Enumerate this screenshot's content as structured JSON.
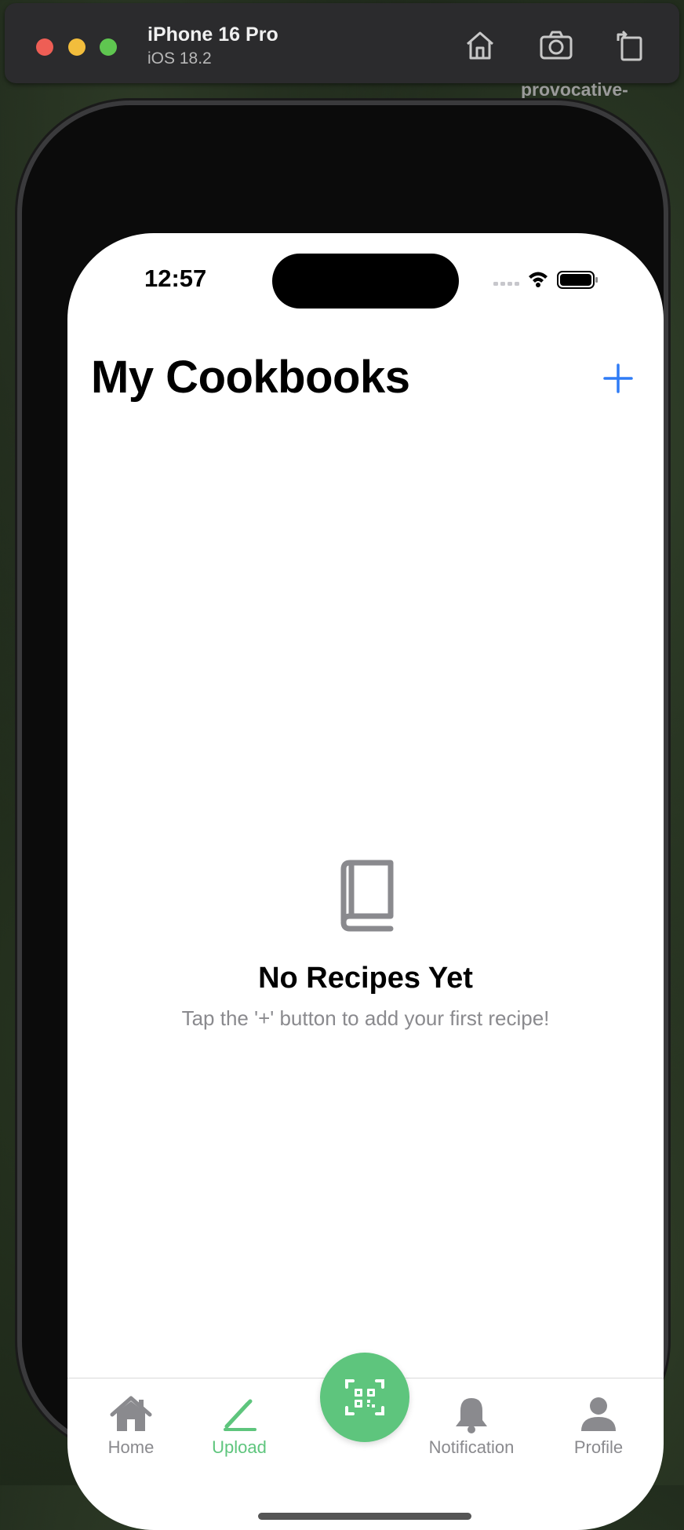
{
  "simulator": {
    "device_name": "iPhone 16 Pro",
    "os_version": "iOS 18.2",
    "watermark": "provocative-\nlegend"
  },
  "status_bar": {
    "time": "12:57"
  },
  "header": {
    "title": "My Cookbooks",
    "add_icon": "plus-icon"
  },
  "empty_state": {
    "icon": "book-icon",
    "title": "No Recipes Yet",
    "subtitle": "Tap the '+' button to add your first recipe!"
  },
  "tabbar": {
    "tabs": [
      {
        "label": "Home",
        "icon": "house-icon",
        "active": false
      },
      {
        "label": "Upload",
        "icon": "pencil-icon",
        "active": true
      },
      {
        "label": "Notification",
        "icon": "bell-icon",
        "active": false
      },
      {
        "label": "Profile",
        "icon": "person-icon",
        "active": false
      }
    ],
    "center_button_icon": "qr-scan-icon"
  },
  "colors": {
    "accent_blue": "#2f7cf6",
    "accent_green": "#5ec57d",
    "inactive_gray": "#8a8a8e"
  }
}
